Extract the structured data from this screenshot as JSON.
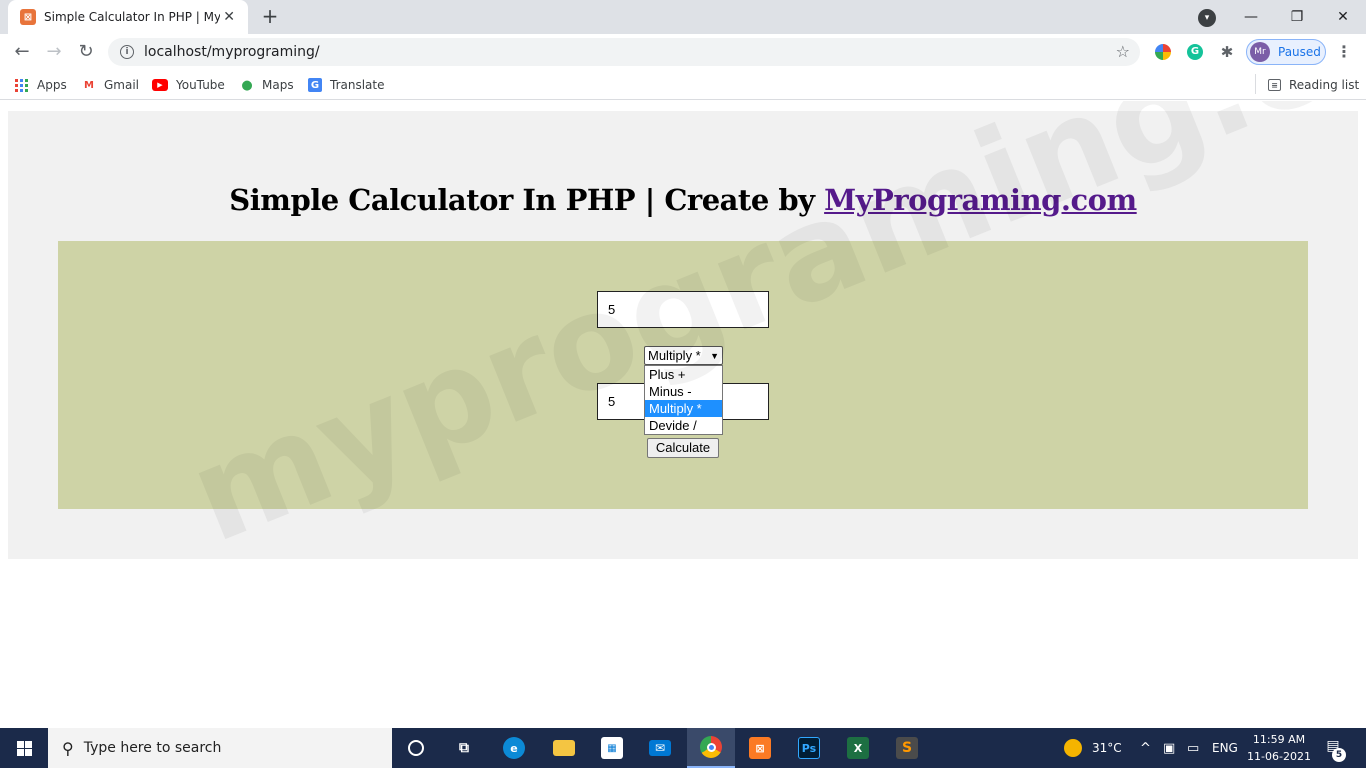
{
  "browser": {
    "tab_title": "Simple Calculator In PHP | MyPro",
    "url": "localhost/myprograming/",
    "profile_label": "Paused",
    "profile_initials": "Mr",
    "bookmarks": [
      "Apps",
      "Gmail",
      "YouTube",
      "Maps",
      "Translate"
    ],
    "reading_list": "Reading list"
  },
  "page": {
    "heading_text": "Simple Calculator In PHP | Create by ",
    "heading_link": "MyPrograming.com",
    "first_number": "5",
    "second_number": "5",
    "operator_selected": "Multiply *",
    "operator_options": [
      "Plus +",
      "Minus -",
      "Multiply *",
      "Devide /"
    ],
    "calculate_label": "Calculate",
    "watermark": "myprograming.com"
  },
  "taskbar": {
    "search_placeholder": "Type here to search",
    "weather": "31°C",
    "language": "ENG",
    "time": "11:59 AM",
    "date": "11-06-2021",
    "notification_count": "5"
  },
  "colors": {
    "calc_box": "#ced3a6",
    "outer_box": "#f1f1f1",
    "link": "#551a8b",
    "selected_option": "#1e90ff",
    "taskbar": "#1b2a4a"
  }
}
